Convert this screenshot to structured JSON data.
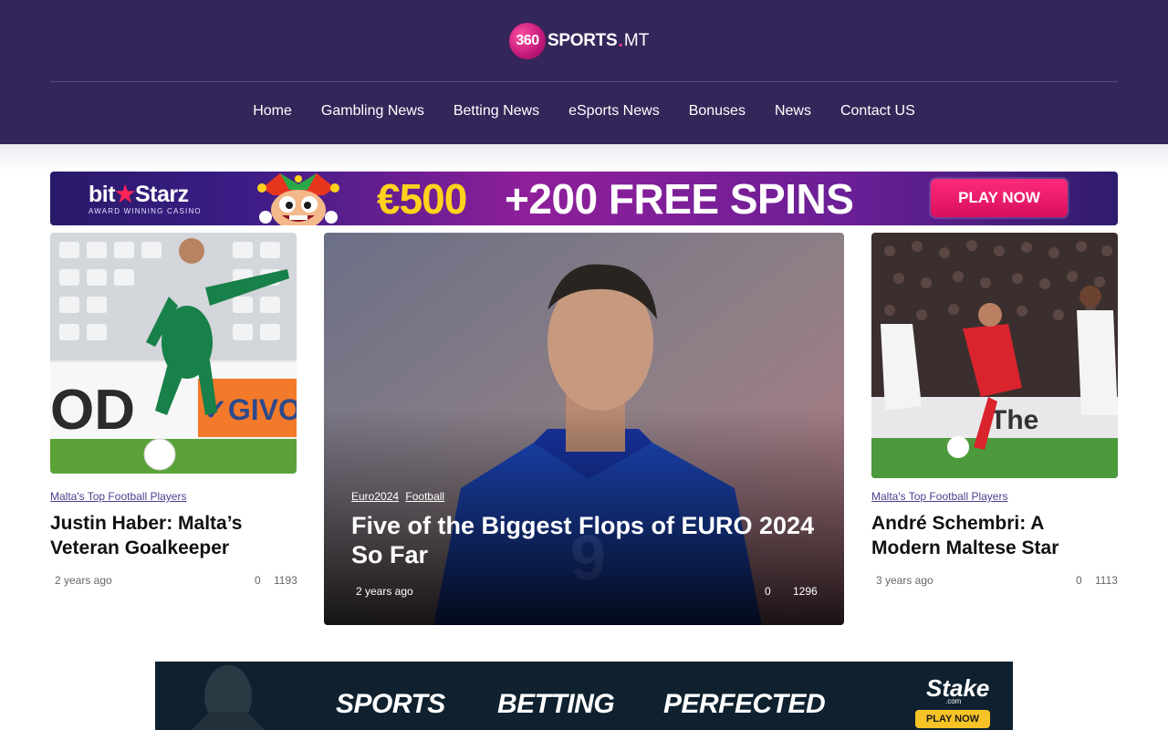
{
  "site": {
    "logo_number": "360",
    "logo_word": "SPORTS",
    "logo_dot": ".",
    "logo_tld": "MT"
  },
  "nav": {
    "items": [
      "Home",
      "Gambling News",
      "Betting News",
      "eSports News",
      "Bonuses",
      "News",
      "Contact US"
    ]
  },
  "banner_ad": {
    "brand": "bit",
    "brand_star": "★",
    "brand_end": "Starz",
    "tagline": "AWARD WINNING CASINO",
    "amount": "€500",
    "offer": "+200 FREE SPINS",
    "cta": "PLAY NOW"
  },
  "articles": [
    {
      "category": "Malta's Top Football Players",
      "title": "Justin Haber: Malta’s Veteran Goalkeeper",
      "time": "2 years ago",
      "comments": "0",
      "views": "1193"
    },
    {
      "categories": [
        "Euro2024",
        "Football"
      ],
      "title": "Five of the Biggest Flops of EURO 2024 So Far",
      "time": "2 years ago",
      "comments": "0",
      "views": "1296"
    },
    {
      "category": "Malta's Top Football Players",
      "title": "André Schembri: A Modern Maltese Star",
      "time": "3 years ago",
      "comments": "0",
      "views": "1113"
    }
  ],
  "bottom_ad": {
    "words": [
      "SPORTS",
      "BETTING",
      "PERFECTED"
    ],
    "brand": "Stake",
    "brand_sub": ".com",
    "cta": "PLAY NOW"
  },
  "colors": {
    "header_bg": "#35265a",
    "tag_link": "#4c3f8f",
    "banner_cta": "#e0166a",
    "stake_bg": "#0f212e",
    "stake_cta": "#f7c326"
  }
}
